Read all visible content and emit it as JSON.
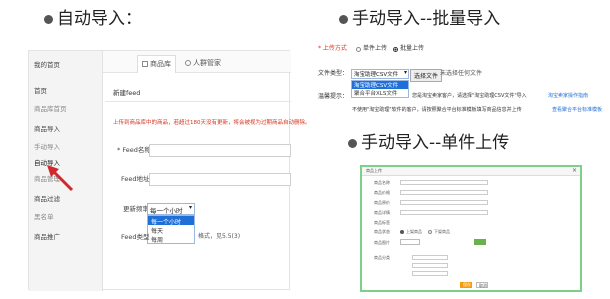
{
  "headings": {
    "auto_import": "自动导入：",
    "manual_batch": "手动导入--批量导入",
    "manual_single": "手动导入--单件上传"
  },
  "auto_panel": {
    "sidebar": [
      {
        "label": "我的首页",
        "sub": false
      },
      {
        "label": "首页",
        "sub": false
      },
      {
        "label": "商品库首页",
        "sub": true
      },
      {
        "label": "商品导入",
        "sub": false
      },
      {
        "label": "手动导入",
        "sub": true
      },
      {
        "label": "自动导入",
        "sub": true
      },
      {
        "label": "商品管理",
        "sub": true
      },
      {
        "label": "商品过滤",
        "sub": false
      },
      {
        "label": "黑名单",
        "sub": true
      },
      {
        "label": "商品推广",
        "sub": false
      }
    ],
    "tabs": [
      "商品库",
      "人群管家"
    ],
    "section_tab": "新建feed",
    "notice": "上传到商品库中的商品，若超过180天没有更新，将会被视为过期商品自动删除。",
    "feed_name_label": "* Feed名称",
    "feed_url_label": "Feed地址",
    "update_freq_label": "更新频率",
    "update_freq_value": "每一个小时",
    "freq_options": [
      "每一个小时",
      "每天",
      "每周"
    ],
    "format_label": "Feed类型",
    "format_hint": "格式，见5.5(3)"
  },
  "batch_panel": {
    "upload_mode_label": "* 上传方式",
    "upload_modes": [
      "单件上传",
      "批量上传"
    ],
    "selected_mode": "批量上传",
    "file_type_label": "文件类型：",
    "file_type_value": "淘宝助理CSV文件",
    "file_type_options": [
      "淘宝助理CSV文件",
      "聚合平台XLS文件"
    ],
    "choose_file_button": "选择文件",
    "no_file_text": "未选择任何文件",
    "tip_label": "温馨提示：",
    "tip_line1": "您是淘宝卖家客户，请选择\"淘宝助理CSV文件\"导入",
    "tip_link1": "淘宝卖家操作指南",
    "tip_line2": "不使用\"淘宝助理\"软件的客户，请按照聚合平台标准模板填写商品信息并上传",
    "tip_link2": "查看聚合平台标准模板"
  },
  "single_panel": {
    "title": "商品上传",
    "close": "×",
    "fields": [
      "商品名称",
      "商品价格",
      "商品原价",
      "商品详情",
      "商品标签",
      "商品状态",
      "商品图片",
      "商品分类"
    ],
    "status_options": [
      "上架商品",
      "下架商品"
    ],
    "save_button": "保存",
    "cancel_button": "取消"
  },
  "colors": {
    "accent": "#1e6fd8",
    "notice_red": "#d9331f",
    "success_green": "#6ab04c",
    "border_green": "#7dd08a",
    "arrow_red": "#d0282d"
  }
}
